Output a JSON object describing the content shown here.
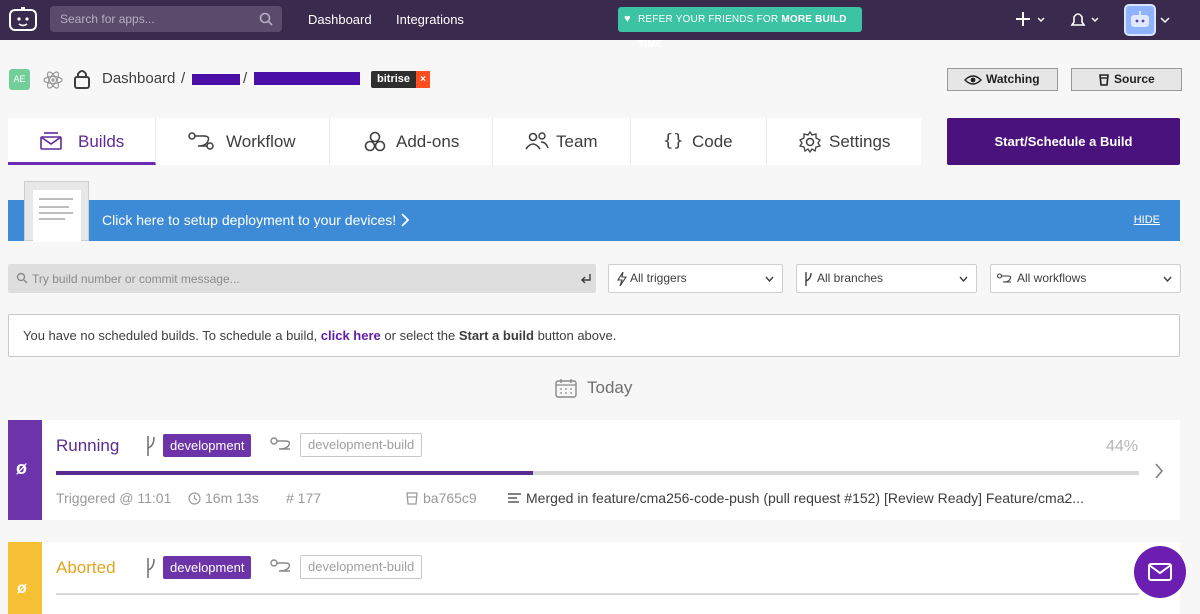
{
  "topnav": {
    "search_placeholder": "Search for apps...",
    "links": [
      "Dashboard",
      "Integrations"
    ],
    "refer_prefix": "REFER YOUR FRIENDS FOR ",
    "refer_bold": "MORE BUILD TIME"
  },
  "breadcrumb": {
    "initials": "AE",
    "root": "Dashboard",
    "sep": "/",
    "tag": "bitrise",
    "tag_close": "×"
  },
  "actions": {
    "watching": "Watching",
    "source": "Source"
  },
  "tabs": [
    "Builds",
    "Workflow",
    "Add-ons",
    "Team",
    "Code",
    "Settings"
  ],
  "start_button": "Start/Schedule a Build",
  "banner": {
    "text": "Click here to setup deployment to your devices!",
    "hide": "HIDE"
  },
  "filters": {
    "search_placeholder": "Try build number or commit message...",
    "triggers": "All triggers",
    "branches": "All branches",
    "workflows": "All workflows"
  },
  "notice": {
    "part1": "You have no scheduled builds. To schedule a build, ",
    "link": "click here",
    "part2": " or select the ",
    "bold": "Start a build",
    "part3": " button above."
  },
  "day_label": "Today",
  "builds": [
    {
      "status": "Running",
      "branch": "development",
      "workflow": "development-build",
      "progress_label": "44%",
      "progress": 0.44,
      "triggered": "Triggered @ 11:01",
      "duration": "16m 13s",
      "number": "# 177",
      "commit": "ba765c9",
      "message": "Merged in feature/cma256-code-push (pull request #152) [Review Ready] Feature/cma2..."
    },
    {
      "status": "Aborted",
      "branch": "development",
      "workflow": "development-build"
    }
  ],
  "colors": {
    "nav_bg": "#3a2a4d",
    "accent": "#4a127d",
    "running": "#6c34a8",
    "aborted": "#f5c033",
    "banner": "#3d8bd6",
    "refer": "#3bc3a3"
  }
}
